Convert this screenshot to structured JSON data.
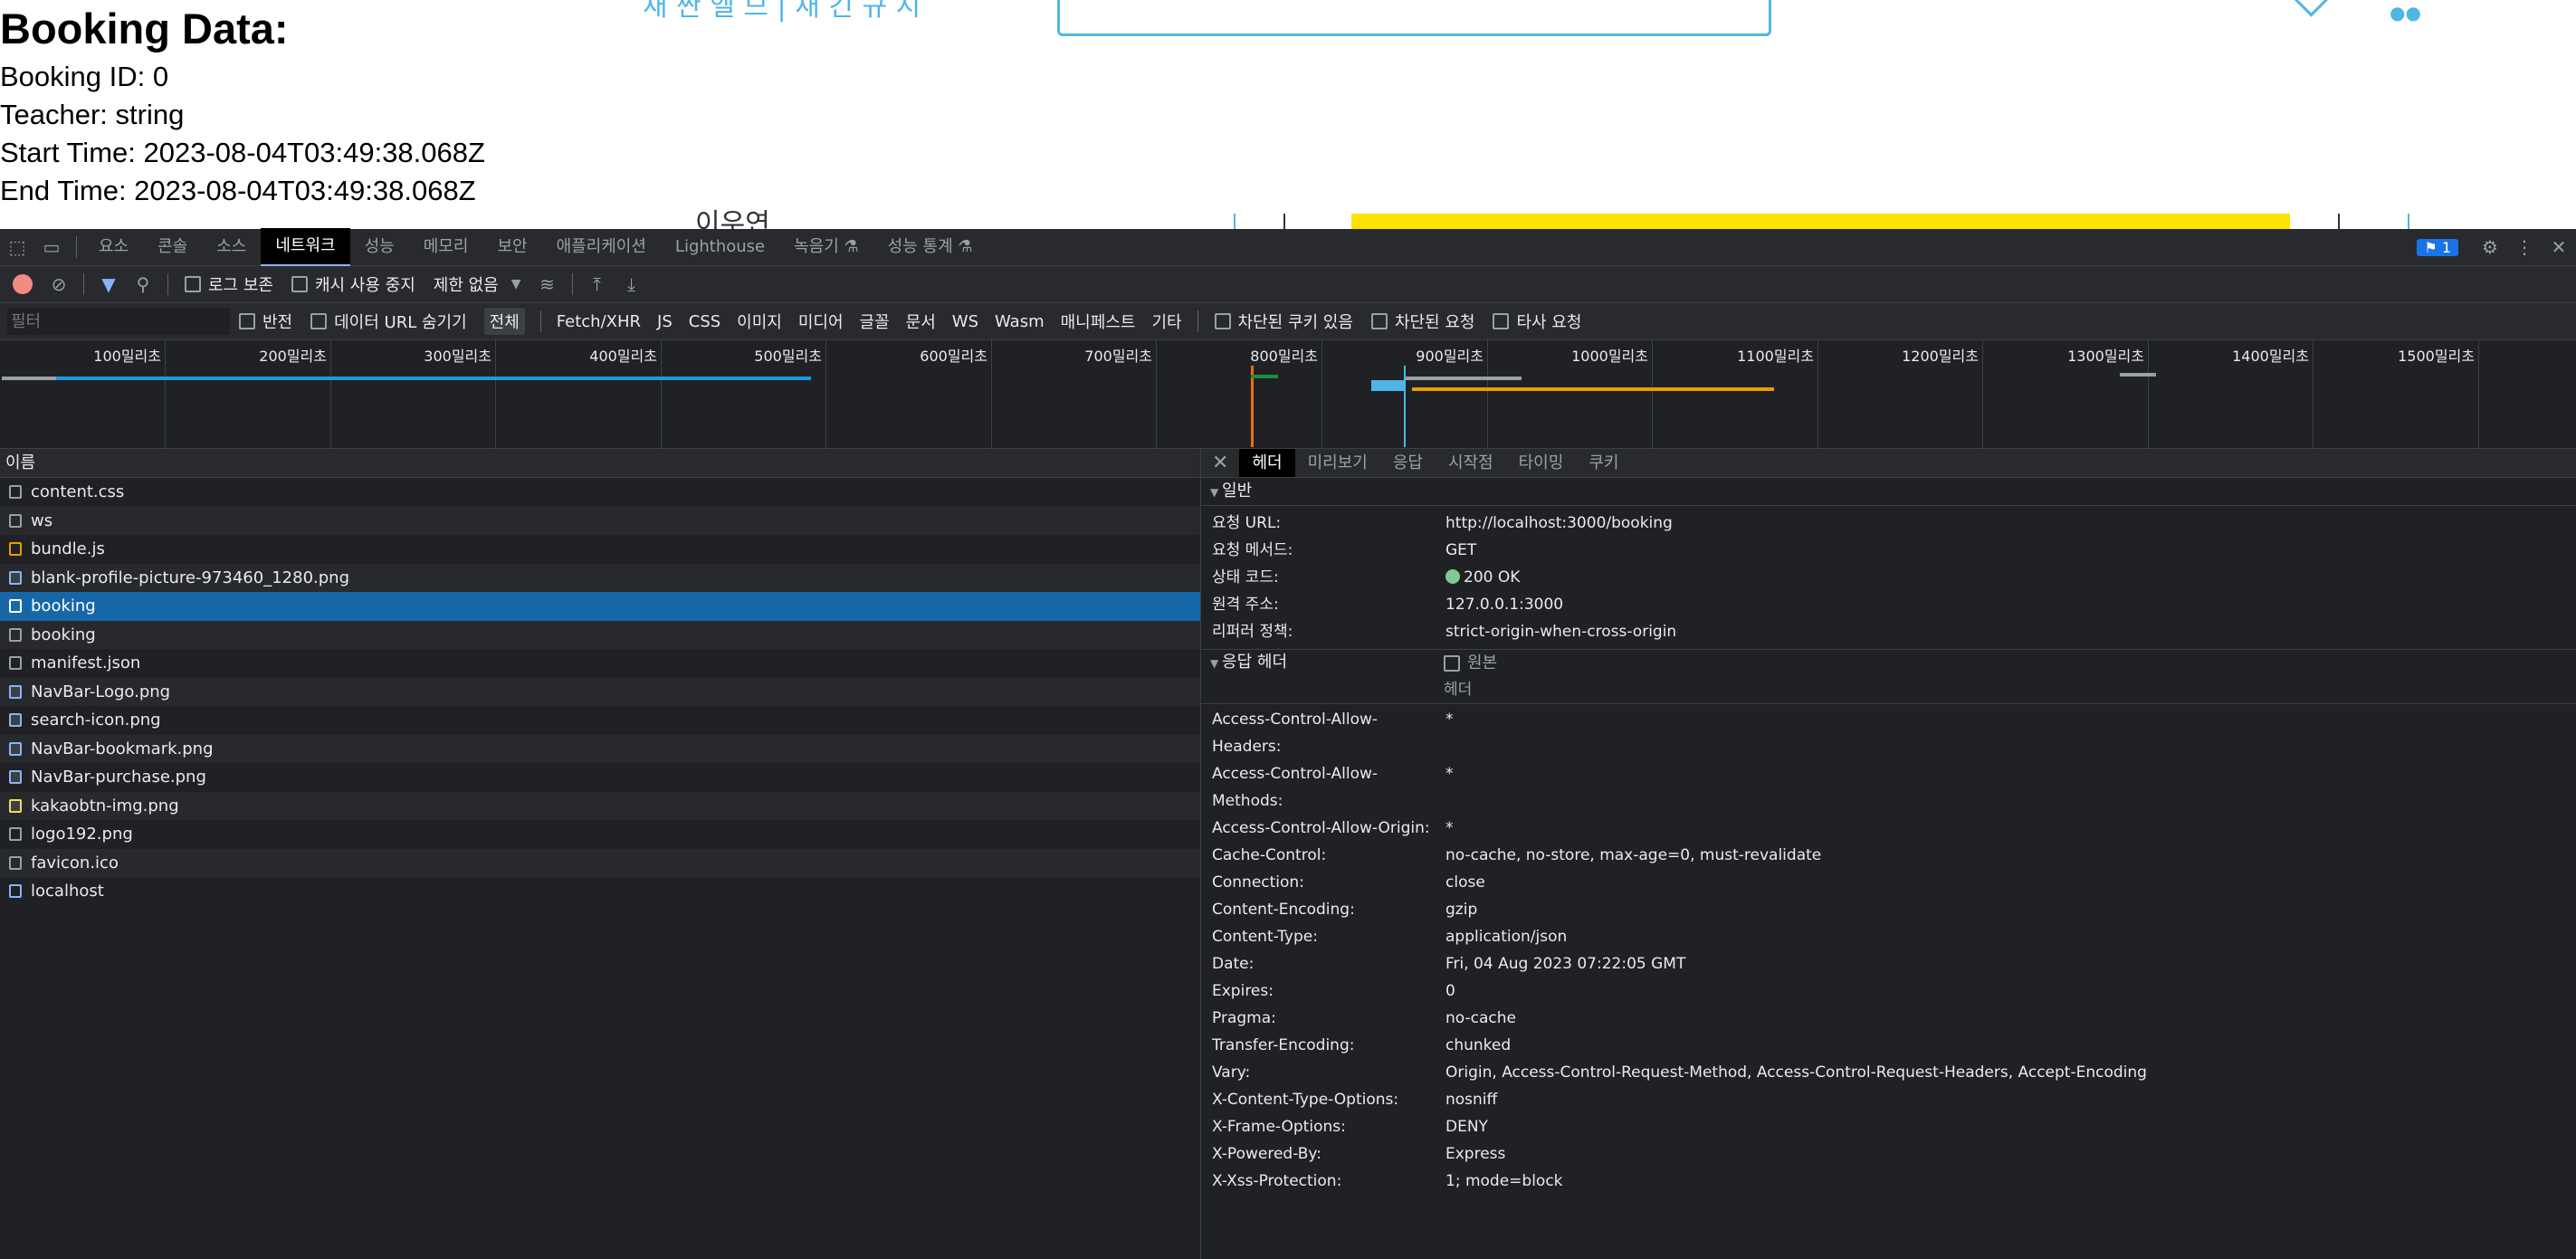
{
  "page": {
    "booking_title": "Booking Data:",
    "booking_lines": [
      "Booking ID: 0",
      "Teacher: string",
      "Start Time: 2023-08-04T03:49:38.068Z",
      "End Time: 2023-08-04T03:49:38.068Z"
    ],
    "nav_fragment": "새 싼 엘 므  |  새 긴 규 시",
    "under_text": "이우연"
  },
  "devtools": {
    "tabs": [
      "요소",
      "콘솔",
      "소스",
      "네트워크",
      "성능",
      "메모리",
      "보안",
      "애플리케이션",
      "Lighthouse",
      "녹음기 ⚗",
      "성능 통계 ⚗"
    ],
    "active_tab": 3,
    "issues_count": "1",
    "toolbar": {
      "preserve_log": "로그 보존",
      "disable_cache": "캐시 사용 중지",
      "throttle": "제한 없음"
    },
    "filter": {
      "placeholder": "필터",
      "invert": "반전",
      "hide_data_urls": "데이터 URL 숨기기",
      "types": [
        "전체",
        "Fetch/XHR",
        "JS",
        "CSS",
        "이미지",
        "미디어",
        "글꼴",
        "문서",
        "WS",
        "Wasm",
        "매니페스트",
        "기타"
      ],
      "blocked_cookies": "차단된 쿠키 있음",
      "blocked_requests": "차단된 요청",
      "third_party": "타사 요청"
    },
    "overview_ticks": [
      "100밀리초",
      "200밀리초",
      "300밀리초",
      "400밀리초",
      "500밀리초",
      "600밀리초",
      "700밀리초",
      "800밀리초",
      "900밀리초",
      "1000밀리초",
      "1100밀리초",
      "1200밀리초",
      "1300밀리초",
      "1400밀리초",
      "1500밀리초"
    ],
    "requests_header": "이름",
    "requests": [
      {
        "name": "content.css",
        "type": "plain"
      },
      {
        "name": "ws",
        "type": "plain"
      },
      {
        "name": "bundle.js",
        "type": "js"
      },
      {
        "name": "blank-profile-picture-973460_1280.png",
        "type": "img"
      },
      {
        "name": "booking",
        "type": "plain",
        "selected": true
      },
      {
        "name": "booking",
        "type": "plain"
      },
      {
        "name": "manifest.json",
        "type": "plain"
      },
      {
        "name": "NavBar-Logo.png",
        "type": "img"
      },
      {
        "name": "search-icon.png",
        "type": "img"
      },
      {
        "name": "NavBar-bookmark.png",
        "type": "img"
      },
      {
        "name": "NavBar-purchase.png",
        "type": "img"
      },
      {
        "name": "kakaobtn-img.png",
        "type": "img"
      },
      {
        "name": "logo192.png",
        "type": "plain"
      },
      {
        "name": "favicon.ico",
        "type": "plain"
      },
      {
        "name": "localhost",
        "type": "doc"
      }
    ],
    "detail_tabs": [
      "헤더",
      "미리보기",
      "응답",
      "시작점",
      "타이밍",
      "쿠키"
    ],
    "general": {
      "title": "일반",
      "rows": [
        {
          "k": "요청 URL:",
          "v": "http://localhost:3000/booking"
        },
        {
          "k": "요청 메서드:",
          "v": "GET"
        },
        {
          "k": "상태 코드:",
          "v": "200 OK"
        },
        {
          "k": "원격 주소:",
          "v": "127.0.0.1:3000"
        },
        {
          "k": "리퍼러 정책:",
          "v": "strict-origin-when-cross-origin"
        }
      ]
    },
    "response_headers": {
      "title": "응답 헤더",
      "raw_label": "원본",
      "column_label": "헤더",
      "rows": [
        {
          "k": "Access-Control-Allow-Headers:",
          "v": "*"
        },
        {
          "k": "Access-Control-Allow-Methods:",
          "v": "*"
        },
        {
          "k": "Access-Control-Allow-Origin:",
          "v": "*"
        },
        {
          "k": "Cache-Control:",
          "v": "no-cache, no-store, max-age=0, must-revalidate"
        },
        {
          "k": "Connection:",
          "v": "close"
        },
        {
          "k": "Content-Encoding:",
          "v": "gzip"
        },
        {
          "k": "Content-Type:",
          "v": "application/json"
        },
        {
          "k": "Date:",
          "v": "Fri, 04 Aug 2023 07:22:05 GMT"
        },
        {
          "k": "Expires:",
          "v": "0"
        },
        {
          "k": "Pragma:",
          "v": "no-cache"
        },
        {
          "k": "Transfer-Encoding:",
          "v": "chunked"
        },
        {
          "k": "Vary:",
          "v": "Origin, Access-Control-Request-Method, Access-Control-Request-Headers, Accept-Encoding"
        },
        {
          "k": "X-Content-Type-Options:",
          "v": "nosniff"
        },
        {
          "k": "X-Frame-Options:",
          "v": "DENY"
        },
        {
          "k": "X-Powered-By:",
          "v": "Express"
        },
        {
          "k": "X-Xss-Protection:",
          "v": "1; mode=block"
        }
      ]
    }
  }
}
